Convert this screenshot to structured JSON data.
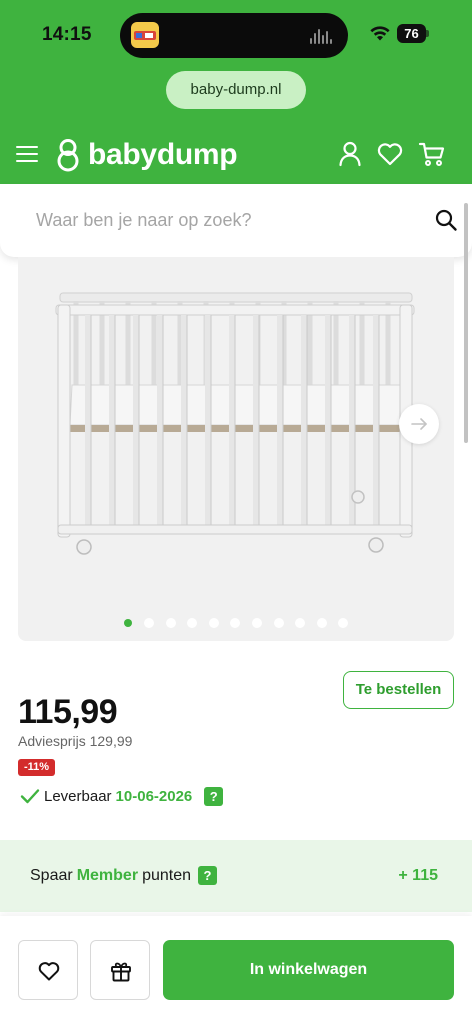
{
  "status_bar": {
    "time": "14:15",
    "battery": "76"
  },
  "browser": {
    "url": "baby-dump.nl"
  },
  "header": {
    "logo_text": "babydump"
  },
  "search": {
    "placeholder": "Waar ben je naar op zoek?"
  },
  "gallery": {
    "image_count": 11,
    "active_index": 0
  },
  "product": {
    "price": "115,99",
    "advice_price": "Adviesprijs 129,99",
    "discount": "-11%",
    "order_button": "Te bestellen",
    "delivery_label": "Leverbaar",
    "delivery_date": "10-06-2026",
    "help": "?"
  },
  "points": {
    "prefix": "Spaar",
    "member": "Member",
    "suffix": "punten",
    "help": "?",
    "value": "+ 115"
  },
  "actions": {
    "add_to_cart": "In winkelwagen"
  },
  "colors": {
    "brand_green": "#3fb33f",
    "discount_red": "#d32c2c",
    "points_bg": "#e9f6e8"
  }
}
